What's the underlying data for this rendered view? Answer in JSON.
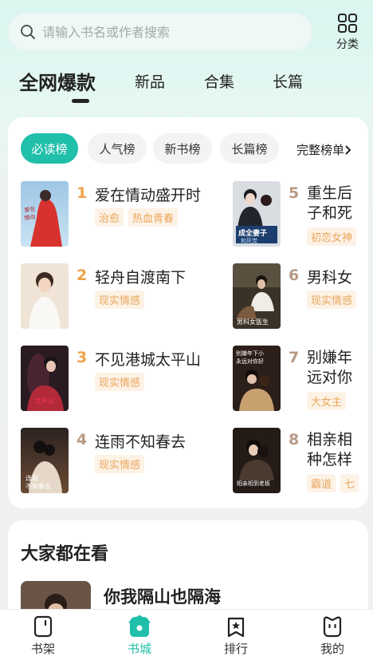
{
  "search": {
    "placeholder": "请输入书名或作者搜索"
  },
  "category_label": "分类",
  "tabs": [
    "全网爆款",
    "新品",
    "合集",
    "长篇"
  ],
  "pills": [
    "必读榜",
    "人气榜",
    "新书榜",
    "长篇榜"
  ],
  "full_list_label": "完整榜单",
  "ranking": [
    {
      "rank": "1",
      "title": "爱在情动盛开时",
      "tags": [
        "治愈",
        "热血青春"
      ],
      "cover_text": "爱在情动盛开时"
    },
    {
      "rank": "2",
      "title": "轻舟自渡南下",
      "tags": [
        "现实情感"
      ],
      "cover_text": ""
    },
    {
      "rank": "3",
      "title": "不见港城太平山",
      "tags": [
        "现实情感"
      ],
      "cover_text": "太平山"
    },
    {
      "rank": "4",
      "title": "连雨不知春去",
      "tags": [
        "现实情感"
      ],
      "cover_text": "连雨不知春去"
    },
    {
      "rank": "5",
      "title": "重生后",
      "title2": "子和死",
      "tags": [
        "初恋女神"
      ],
      "cover_text": "成全妻子和死党"
    },
    {
      "rank": "6",
      "title": "男科女",
      "tags": [
        "现实情感"
      ],
      "cover_text": "男科女医生"
    },
    {
      "rank": "7",
      "title": "别嫌年",
      "title2": "远对你",
      "tags": [
        "大女主"
      ],
      "cover_text": "别嫌年下小 永远对你好"
    },
    {
      "rank": "8",
      "title": "相亲相",
      "title2": "种怎样",
      "tags": [
        "霸道",
        "七"
      ],
      "cover_text": "相亲相到老板"
    }
  ],
  "section2": {
    "title": "大家都在看",
    "book_title": "你我隔山也隔海"
  },
  "bottom_nav": [
    "书架",
    "书城",
    "排行",
    "我的"
  ],
  "colors": {
    "accent": "#1fbfa9",
    "rank_top": "#f0a24a",
    "rank_other": "#b89a85",
    "tag_text": "#e9a75c",
    "tag_bg": "#fdf2e6"
  }
}
